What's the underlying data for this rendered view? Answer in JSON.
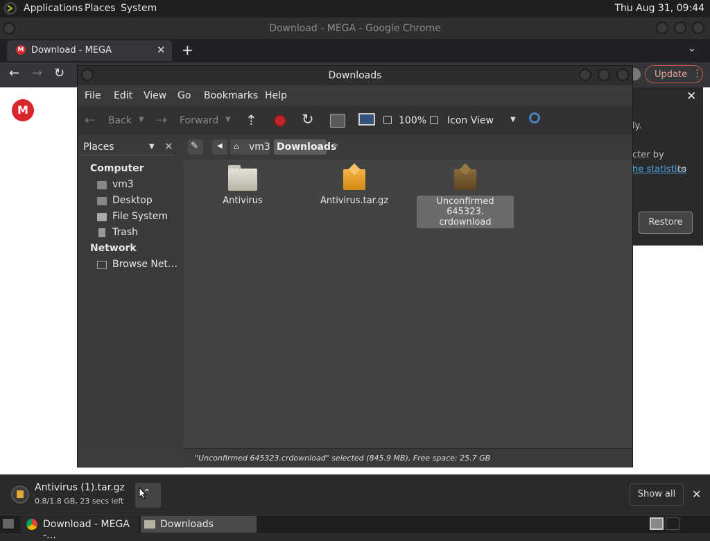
{
  "top_panel": {
    "menus": [
      "Applications",
      "Places",
      "System"
    ],
    "clock": "Thu Aug 31, 09:44"
  },
  "chrome": {
    "window_title": "Download - MEGA - Google Chrome",
    "tab_label": "Download - MEGA",
    "new_tab_symbol": "+",
    "update_label": "Update",
    "side_text": [
      "ly.",
      "cter by",
      "he statistics",
      " to"
    ],
    "restore_label": "Restore",
    "brand_color": "#d9272e"
  },
  "file_manager": {
    "title": "Downloads",
    "menu": [
      "File",
      "Edit",
      "View",
      "Go",
      "Bookmarks",
      "Help"
    ],
    "toolbar": {
      "back": "Back",
      "forward": "Forward",
      "zoom": "100%",
      "view_mode": "Icon View"
    },
    "sidebar_header": "Places",
    "location": {
      "crumbs": [
        "vm3",
        "Downloads"
      ]
    },
    "sidebar": {
      "computer_heading": "Computer",
      "computer_items": [
        "vm3",
        "Desktop",
        "File System",
        "Trash"
      ],
      "network_heading": "Network",
      "network_items": [
        "Browse Net…"
      ]
    },
    "files": [
      {
        "name": "Antivirus",
        "type": "folder",
        "icon": "folder-icon"
      },
      {
        "name": "Antivirus.tar.gz",
        "type": "archive",
        "icon": "package-icon"
      },
      {
        "name_line1": "Unconfirmed 645323.",
        "name_line2": "crdownload",
        "type": "partial",
        "icon": "package-dark-icon",
        "selected": true
      }
    ],
    "status": "\"Unconfirmed 645323.crdownload\" selected (845.9 MB), Free space: 25.7 GB"
  },
  "download_bar": {
    "filename": "Antivirus (1).tar.gz",
    "progress": "0.8/1.8 GB, 23 secs left",
    "show_all": "Show all"
  },
  "taskbar": {
    "items": [
      "Download - MEGA -…",
      "Downloads"
    ]
  }
}
